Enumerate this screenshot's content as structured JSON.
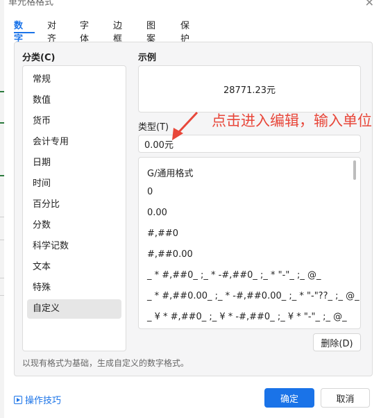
{
  "window": {
    "title": "单元格格式",
    "close_glyph": "✕"
  },
  "tabs": [
    {
      "label": "数字",
      "active": true
    },
    {
      "label": "对齐"
    },
    {
      "label": "字体"
    },
    {
      "label": "边框"
    },
    {
      "label": "图案"
    },
    {
      "label": "保护"
    }
  ],
  "category": {
    "title": "分类(C)",
    "items": [
      "常规",
      "数值",
      "货币",
      "会计专用",
      "日期",
      "时间",
      "百分比",
      "分数",
      "科学记数",
      "文本",
      "特殊",
      "自定义"
    ],
    "selected": "自定义"
  },
  "sample": {
    "title": "示例",
    "value": "28771.23元"
  },
  "type_field": {
    "label": "类型(T)",
    "value": "0.00元"
  },
  "annotation": {
    "text": "点击进入编辑，输入单位",
    "color": "#e8473a"
  },
  "format_list": [
    "G/通用格式",
    "0",
    "0.00",
    "#,##0",
    "#,##0.00",
    "_ * #,##0_ ;_ * -#,##0_ ;_ * \"-\"_ ;_ @_",
    "_ * #,##0.00_ ;_ * -#,##0.00_ ;_ * \"-\"??_ ;_ @_",
    "_ ¥ * #,##0_ ;_ ¥ * -#,##0_ ;_ ¥ * \"-\"_ ;_ @_"
  ],
  "buttons": {
    "delete": "删除(D)",
    "ok": "确定",
    "cancel": "取消",
    "tips": "操作技巧"
  },
  "hint": "以现有格式为基础，生成自定义的数字格式。",
  "colors": {
    "accent": "#1a73e8",
    "annotation": "#e8473a"
  },
  "icons": {
    "tips": "play-square-icon",
    "close": "close-icon"
  }
}
